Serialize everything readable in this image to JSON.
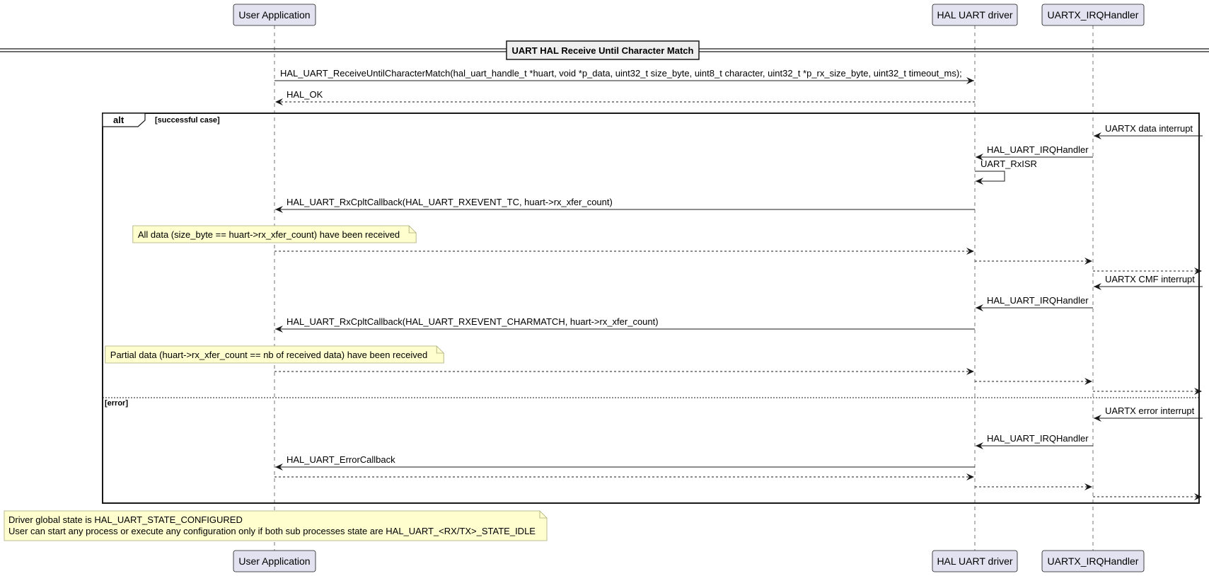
{
  "participants": [
    {
      "id": "user",
      "label": "User Application"
    },
    {
      "id": "hal",
      "label": "HAL UART driver"
    },
    {
      "id": "irq",
      "label": "UARTX_IRQHandler"
    }
  ],
  "divider_title": "UART HAL Receive Until Character Match",
  "pre_messages": [
    {
      "from": "user",
      "to": "hal",
      "label": "HAL_UART_ReceiveUntilCharacterMatch(hal_uart_handle_t *huart, void *p_data, uint32_t size_byte, uint8_t character, uint32_t *p_rx_size_byte, uint32_t timeout_ms);",
      "dashed": false
    },
    {
      "from": "hal",
      "to": "user",
      "label": "HAL_OK",
      "dashed": true
    }
  ],
  "alt": {
    "keyword": "alt",
    "sections": [
      {
        "guard": "[successful case]",
        "events": [
          {
            "kind": "msg",
            "from": "edge",
            "to": "irq",
            "label": "UARTX data interrupt",
            "dashed": false
          },
          {
            "kind": "msg",
            "from": "irq",
            "to": "hal",
            "label": "HAL_UART_IRQHandler",
            "dashed": false
          },
          {
            "kind": "self",
            "on": "hal",
            "label": "UART_RxISR"
          },
          {
            "kind": "msg",
            "from": "hal",
            "to": "user",
            "label": "HAL_UART_RxCpltCallback(HAL_UART_RXEVENT_TC, huart->rx_xfer_count)",
            "dashed": false
          },
          {
            "kind": "note",
            "label": "All data (size_byte == huart->rx_xfer_count) have been received"
          },
          {
            "kind": "msg",
            "from": "user",
            "to": "hal",
            "label": "",
            "dashed": true
          },
          {
            "kind": "msg",
            "from": "hal",
            "to": "irq",
            "label": "",
            "dashed": true
          },
          {
            "kind": "msg",
            "from": "irq",
            "to": "edge",
            "label": "",
            "dashed": true
          },
          {
            "kind": "msg",
            "from": "edge",
            "to": "irq",
            "label": "UARTX CMF interrupt",
            "dashed": false
          },
          {
            "kind": "msg",
            "from": "irq",
            "to": "hal",
            "label": "HAL_UART_IRQHandler",
            "dashed": false
          },
          {
            "kind": "msg",
            "from": "hal",
            "to": "user",
            "label": "HAL_UART_RxCpltCallback(HAL_UART_RXEVENT_CHARMATCH, huart->rx_xfer_count)",
            "dashed": false
          },
          {
            "kind": "note",
            "label": "Partial data (huart->rx_xfer_count == nb of received data) have been received"
          },
          {
            "kind": "msg",
            "from": "user",
            "to": "hal",
            "label": "",
            "dashed": true
          },
          {
            "kind": "msg",
            "from": "hal",
            "to": "irq",
            "label": "",
            "dashed": true
          },
          {
            "kind": "msg",
            "from": "irq",
            "to": "edge",
            "label": "",
            "dashed": true
          }
        ]
      },
      {
        "guard": "[error]",
        "events": [
          {
            "kind": "msg",
            "from": "edge",
            "to": "irq",
            "label": "UARTX error interrupt",
            "dashed": false
          },
          {
            "kind": "msg",
            "from": "irq",
            "to": "hal",
            "label": "HAL_UART_IRQHandler",
            "dashed": false
          },
          {
            "kind": "msg",
            "from": "hal",
            "to": "user",
            "label": "HAL_UART_ErrorCallback",
            "dashed": false
          },
          {
            "kind": "msg",
            "from": "user",
            "to": "hal",
            "label": "",
            "dashed": true
          },
          {
            "kind": "msg",
            "from": "hal",
            "to": "irq",
            "label": "",
            "dashed": true
          },
          {
            "kind": "msg",
            "from": "irq",
            "to": "edge",
            "label": "",
            "dashed": true
          }
        ]
      }
    ]
  },
  "final_note": [
    "Driver global state is HAL_UART_STATE_CONFIGURED",
    "User can start any process or execute any configuration only if both sub processes state are HAL_UART_<RX/TX>_STATE_IDLE"
  ],
  "colors": {
    "participant_fill": "#e2e2f0",
    "participant_stroke": "#181818",
    "note_fill": "#fefece",
    "note_stroke": "#a8a878",
    "line": "#181818"
  }
}
